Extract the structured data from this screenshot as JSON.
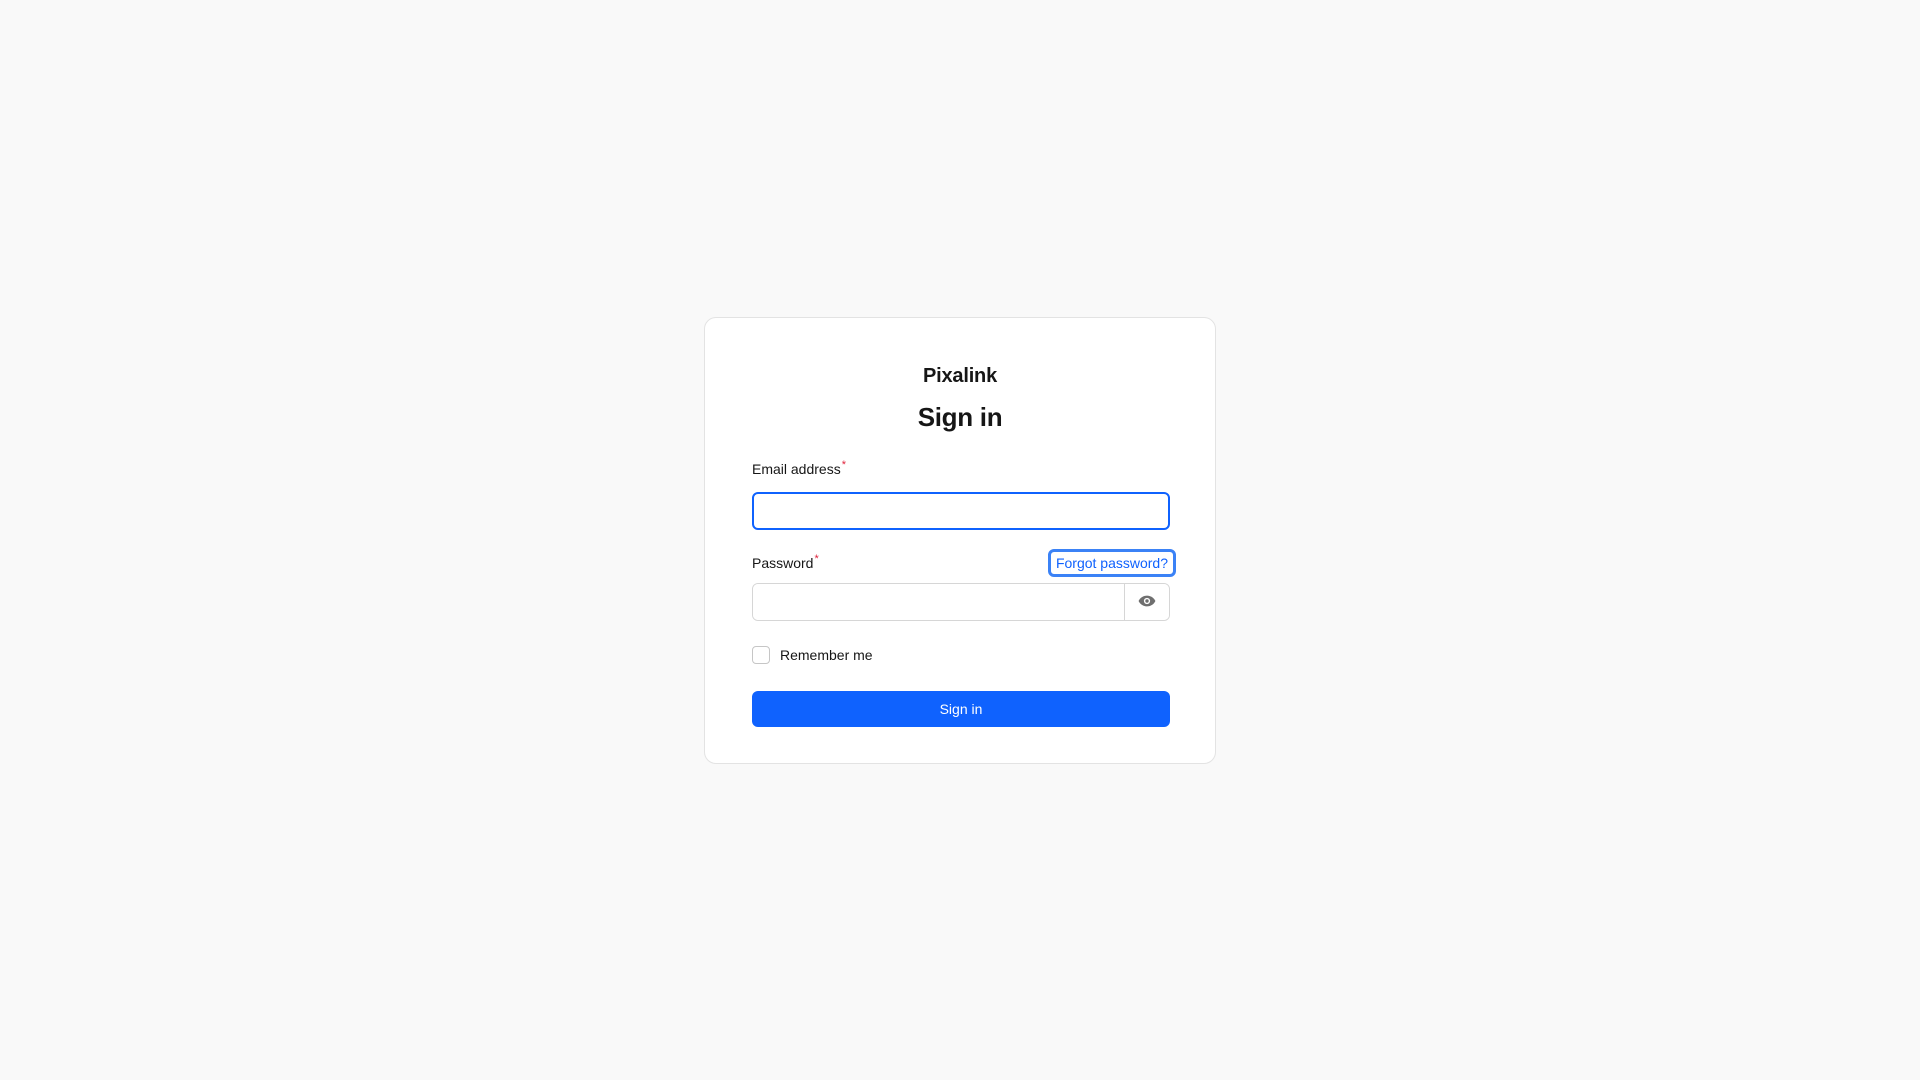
{
  "app": {
    "brand": "Pixalink",
    "title": "Sign in"
  },
  "form": {
    "email": {
      "label": "Email address",
      "required_mark": "*",
      "value": "",
      "placeholder": ""
    },
    "password": {
      "label": "Password",
      "required_mark": "*",
      "value": "",
      "placeholder": "",
      "forgot_label": "Forgot password?",
      "toggle_icon": "eye-icon"
    },
    "remember": {
      "label": "Remember me",
      "checked": false
    },
    "submit_label": "Sign in"
  },
  "colors": {
    "accent": "#0f62fe",
    "required": "#e0223b",
    "background": "#f9f9f9"
  }
}
